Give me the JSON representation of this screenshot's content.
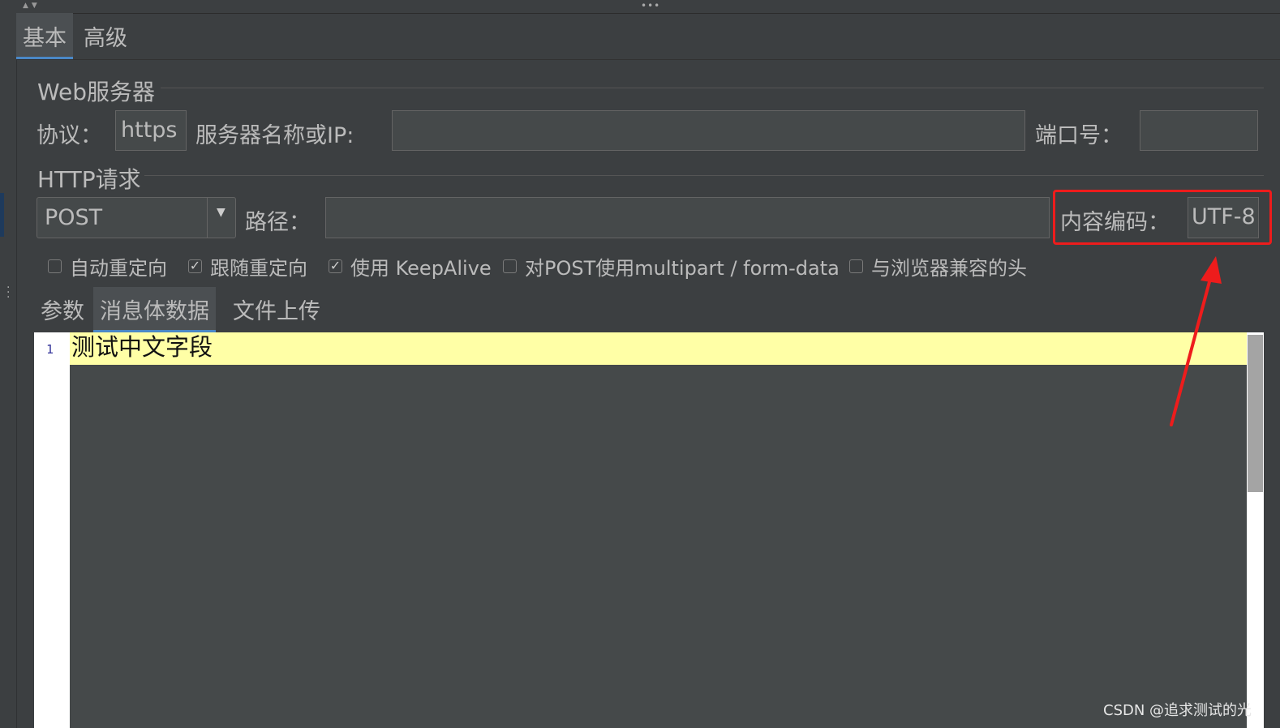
{
  "main_tabs": [
    "基本",
    "高级"
  ],
  "web_server": {
    "title": "Web服务器",
    "protocol_label": "协议：",
    "protocol_value": "https",
    "server_label": "服务器名称或IP:",
    "server_value": "",
    "port_label": "端口号：",
    "port_value": ""
  },
  "http_request": {
    "title": "HTTP请求",
    "method": "POST",
    "path_label": "路径：",
    "path_value": "",
    "encoding_label": "内容编码：",
    "encoding_value": "UTF-8"
  },
  "options": [
    {
      "label": "自动重定向",
      "checked": false
    },
    {
      "label": "跟随重定向",
      "checked": true
    },
    {
      "label": "使用 KeepAlive",
      "checked": true
    },
    {
      "label": "对POST使用multipart / form-data",
      "checked": false
    },
    {
      "label": "与浏览器兼容的头",
      "checked": false
    }
  ],
  "body_tabs": [
    "参数",
    "消息体数据",
    "文件上传"
  ],
  "editor": {
    "line_number": "1",
    "content": "测试中文字段"
  },
  "check_glyph": "✓",
  "watermark": "CSDN @追求测试的光",
  "colors": {
    "background": "#3c3f41",
    "current_line": "#ffffa6",
    "tab_underline": "#4a88c7",
    "annotation": "#ee1c1c"
  }
}
